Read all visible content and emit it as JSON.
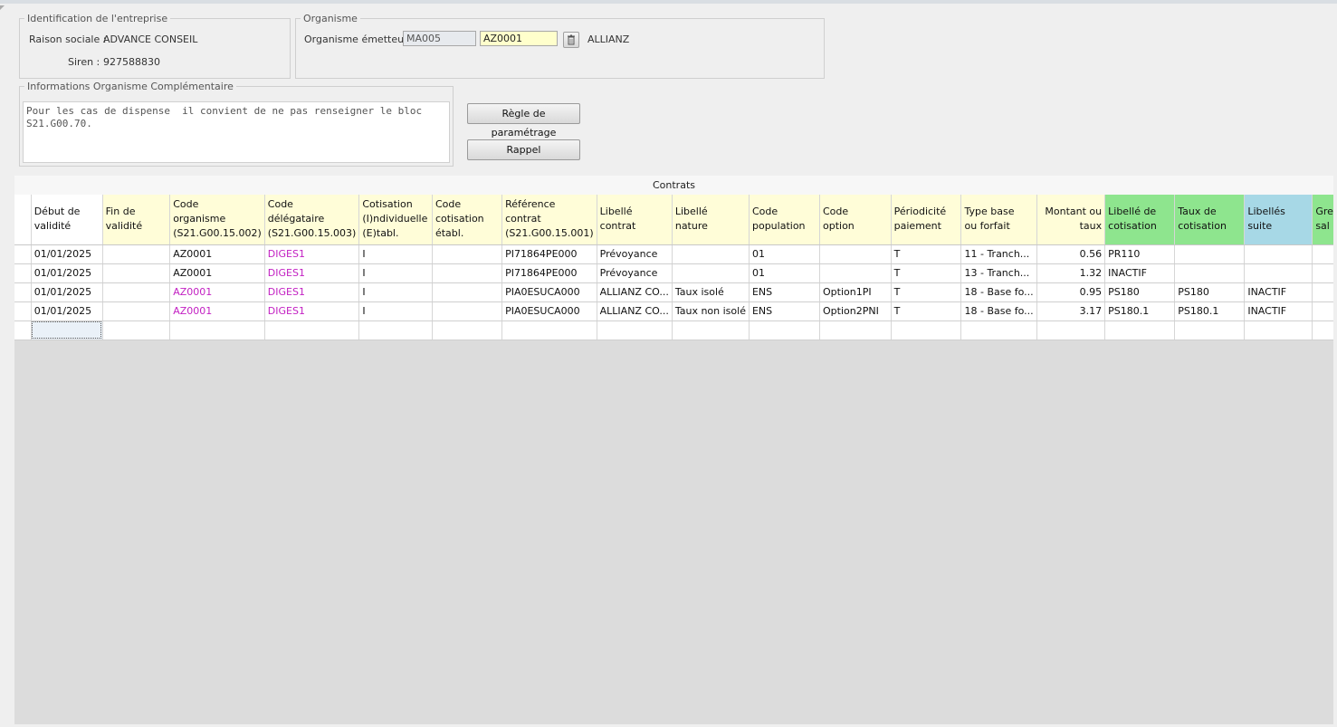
{
  "identification": {
    "legend": "Identification de l'entreprise",
    "raison_label": "Raison sociale :",
    "raison_value": "ADVANCE CONSEIL",
    "siren_label": "Siren :",
    "siren_value": "927588830"
  },
  "organisme": {
    "legend": "Organisme",
    "emetteur_label": "Organisme émetteur :",
    "code1": "MA005",
    "code2": "AZ0001",
    "name": "ALLIANZ"
  },
  "info": {
    "legend": "Informations Organisme Complémentaire",
    "text": "Pour les cas de dispense  il convient de ne pas renseigner le bloc\nS21.G00.70."
  },
  "buttons": {
    "regle": "Règle de paramétrage",
    "rappel": "Rappel"
  },
  "contrats": {
    "title": "Contrats",
    "headers": [
      "",
      "Début de\nvalidité",
      "Fin de\nvalidité",
      "Code\norganisme\n(S21.G00.15.002)",
      "Code\ndélégataire\n(S21.G00.15.003)",
      "Cotisation\n(I)ndividuelle\n(E)tabl.",
      "Code\ncotisation\nétabl.",
      "Référence\ncontrat\n(S21.G00.15.001)",
      "Libellé\ncontrat",
      "Libellé\nnature",
      "Code\npopulation",
      "Code\noption",
      "Périodicité\npaiement",
      "Type base\nou forfait",
      "Montant ou\ntaux",
      "Libellé de\ncotisation",
      "Taux de\ncotisation",
      "Libellés\nsuite",
      "Gre\nsal"
    ],
    "rows": [
      [
        "",
        "01/01/2025",
        "",
        "AZ0001",
        "DIGES1",
        "I",
        "",
        "PI71864PE000",
        "Prévoyance",
        "",
        "01",
        "",
        "T",
        "11 - Tranch...",
        "0.56",
        "PR110",
        "",
        "",
        ""
      ],
      [
        "",
        "01/01/2025",
        "",
        "AZ0001",
        "DIGES1",
        "I",
        "",
        "PI71864PE000",
        "Prévoyance",
        "",
        "01",
        "",
        "T",
        "13 - Tranch...",
        "1.32",
        "INACTIF",
        "",
        "",
        ""
      ],
      [
        "",
        "01/01/2025",
        "",
        "AZ0001",
        "DIGES1",
        "I",
        "",
        "PIA0ESUCA000",
        "ALLIANZ CO...",
        "Taux isolé",
        "ENS",
        "Option1PI",
        "T",
        "18 - Base fo...",
        "0.95",
        "PS180",
        "PS180",
        "INACTIF",
        ""
      ],
      [
        "",
        "01/01/2025",
        "",
        "AZ0001",
        "DIGES1",
        "I",
        "",
        "PIA0ESUCA000",
        "ALLIANZ CO...",
        "Taux non isolé",
        "ENS",
        "Option2PNI",
        "T",
        "18 - Base fo...",
        "3.17",
        "PS180.1",
        "PS180.1",
        "INACTIF",
        ""
      ],
      [
        "",
        "",
        "",
        "",
        "",
        "",
        "",
        "",
        "",
        "",
        "",
        "",
        "",
        "",
        "",
        "",
        "",
        "",
        ""
      ]
    ]
  },
  "colors": {
    "header_yellow": "#fffdd8",
    "header_green": "#8ee58e",
    "header_blue": "#a7d8e6",
    "magenta_text": "#c21fc2",
    "input_highlight": "#ffffcc"
  }
}
